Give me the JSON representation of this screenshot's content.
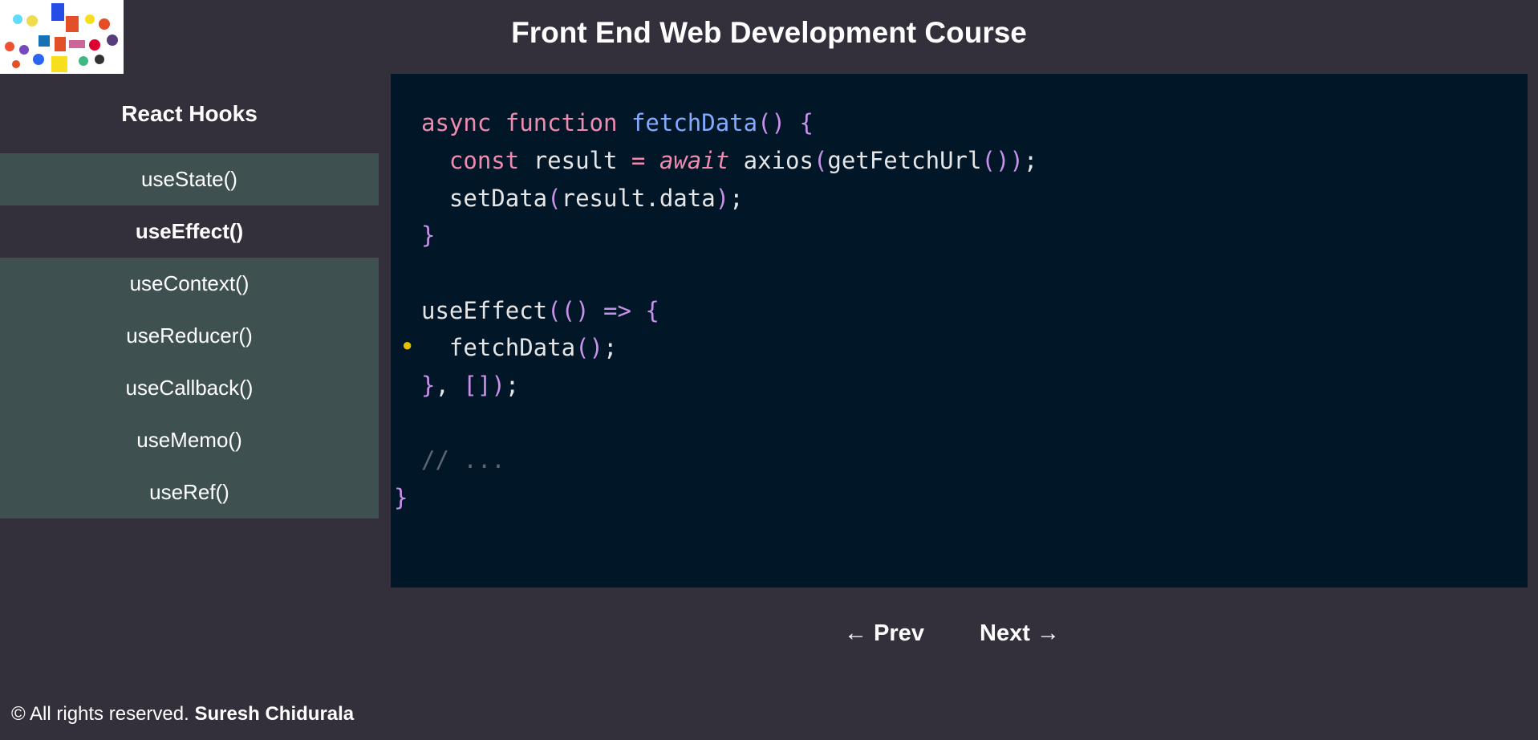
{
  "header": {
    "title": "Front End Web Development Course",
    "logo_icon": "web-technologies-logo-collage"
  },
  "sidebar": {
    "heading": "React Hooks",
    "items": [
      {
        "label": "useState()",
        "active": false
      },
      {
        "label": "useEffect()",
        "active": true
      },
      {
        "label": "useContext()",
        "active": false
      },
      {
        "label": "useReducer()",
        "active": false
      },
      {
        "label": "useCallback()",
        "active": false
      },
      {
        "label": "useMemo()",
        "active": false
      },
      {
        "label": "useRef()",
        "active": false
      }
    ]
  },
  "code": {
    "lines": [
      "async function fetchData() {",
      "  const result = await axios(getFetchUrl());",
      "  setData(result.data);",
      "}",
      "",
      "useEffect(() => {",
      "  fetchData();",
      "}, []);",
      "",
      "// ...",
      "}"
    ],
    "background": "#011627"
  },
  "navigation": {
    "prev_label": "← Prev",
    "next_label": "Next →"
  },
  "footer": {
    "text": "© All rights reserved.",
    "author": "Suresh Chidurala"
  },
  "colors": {
    "page_bg": "#332f3b",
    "sidebar_item_bg": "#3f5050"
  }
}
